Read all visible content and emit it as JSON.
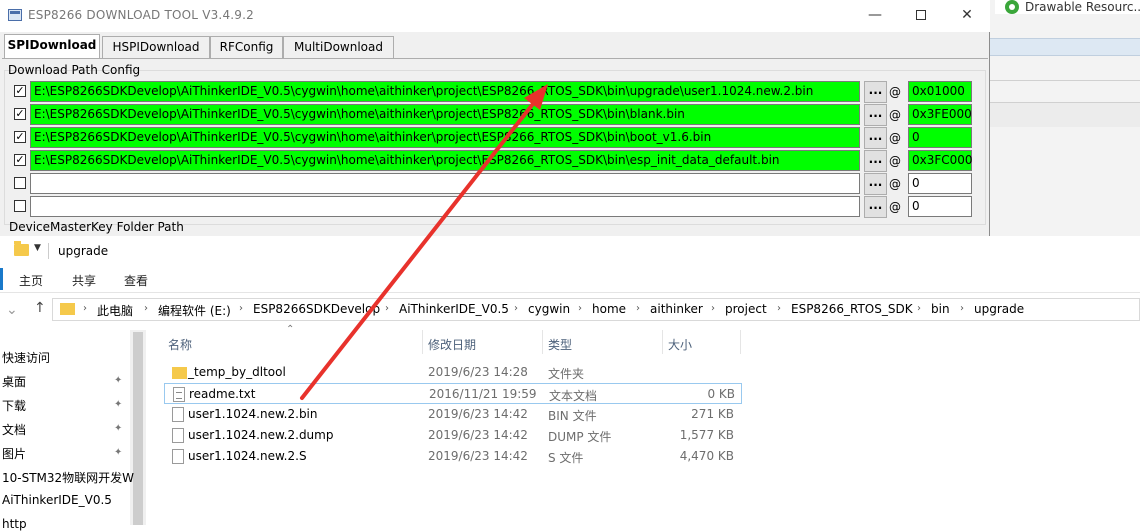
{
  "ide": {
    "top_label": "Drawable Resourc..."
  },
  "tool": {
    "title": "ESP8266 DOWNLOAD TOOL V3.4.9.2",
    "tabs": [
      "SPIDownload",
      "HSPIDownload",
      "RFConfig",
      "MultiDownload"
    ],
    "group_label": "Download Path Config",
    "browse_label": "...",
    "at_label": "@",
    "rows": [
      {
        "checked": "✓",
        "path": "E:\\ESP8266SDKDevelop\\AiThinkerIDE_V0.5\\cygwin\\home\\aithinker\\project\\ESP8266_RTOS_SDK\\bin\\upgrade\\user1.1024.new.2.bin",
        "addr": "0x01000",
        "green": true
      },
      {
        "checked": "✓",
        "path": "E:\\ESP8266SDKDevelop\\AiThinkerIDE_V0.5\\cygwin\\home\\aithinker\\project\\ESP8266_RTOS_SDK\\bin\\blank.bin",
        "addr": "0x3FE000",
        "green": true
      },
      {
        "checked": "✓",
        "path": "E:\\ESP8266SDKDevelop\\AiThinkerIDE_V0.5\\cygwin\\home\\aithinker\\project\\ESP8266_RTOS_SDK\\bin\\boot_v1.6.bin",
        "addr": "0",
        "green": true
      },
      {
        "checked": "✓",
        "path": "E:\\ESP8266SDKDevelop\\AiThinkerIDE_V0.5\\cygwin\\home\\aithinker\\project\\ESP8266_RTOS_SDK\\bin\\esp_init_data_default.bin",
        "addr": "0x3FC000",
        "green": true
      },
      {
        "checked": "",
        "path": "",
        "addr": "0",
        "green": false
      },
      {
        "checked": "",
        "path": "",
        "addr": "0",
        "green": false
      }
    ],
    "dmk_label": "DeviceMasterKey Folder Path"
  },
  "explorer": {
    "title": "upgrade",
    "ribbon_tabs": [
      "主页",
      "共享",
      "查看"
    ],
    "breadcrumb": [
      "此电脑",
      "编程软件 (E:)",
      "ESP8266SDKDevelop",
      "AiThinkerIDE_V0.5",
      "cygwin",
      "home",
      "aithinker",
      "project",
      "ESP8266_RTOS_SDK",
      "bin",
      "upgrade"
    ],
    "nav_items": [
      "快速访问",
      "桌面",
      "下载",
      "文档",
      "图片",
      "10-STM32物联网开发W",
      "AiThinkerIDE_V0.5",
      "http"
    ],
    "columns": {
      "name": "名称",
      "date": "修改日期",
      "type": "类型",
      "size": "大小"
    },
    "files": [
      {
        "name": "_temp_by_dltool",
        "date": "2019/6/23 14:28",
        "type": "文件夹",
        "size": "",
        "kind": "folder"
      },
      {
        "name": "readme.txt",
        "date": "2016/11/21 19:59",
        "type": "文本文档",
        "size": "0 KB",
        "kind": "txt"
      },
      {
        "name": "user1.1024.new.2.bin",
        "date": "2019/6/23 14:42",
        "type": "BIN 文件",
        "size": "271 KB",
        "kind": "file"
      },
      {
        "name": "user1.1024.new.2.dump",
        "date": "2019/6/23 14:42",
        "type": "DUMP 文件",
        "size": "1,577 KB",
        "kind": "file"
      },
      {
        "name": "user1.1024.new.2.S",
        "date": "2019/6/23 14:42",
        "type": "S 文件",
        "size": "4,470 KB",
        "kind": "file"
      }
    ]
  },
  "colors": {
    "highlight_green": "#00ff00",
    "arrow_red": "#e8322c",
    "folder_yellow": "#f5c94b"
  }
}
